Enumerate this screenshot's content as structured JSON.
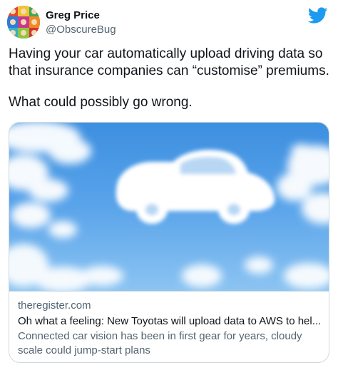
{
  "tweet": {
    "author": {
      "display_name": "Greg Price",
      "handle": "@ObscureBug"
    },
    "text": [
      "Having your car automatically upload driving data so that insurance companies can “customise” premiums.",
      "What could possibly go wrong."
    ],
    "brand_color": "#1d9bf0"
  },
  "link_card": {
    "domain": "theregister.com",
    "title": "Oh what a feeling: New Toyotas will upload data to AWS to hel...",
    "description": "Connected car vision has been in first gear for years, cloudy scale could jump-start plans",
    "image_icon": "car-shaped-cloud-in-blue-sky"
  },
  "icons": [
    "avatar",
    "twitter-bird-icon"
  ]
}
